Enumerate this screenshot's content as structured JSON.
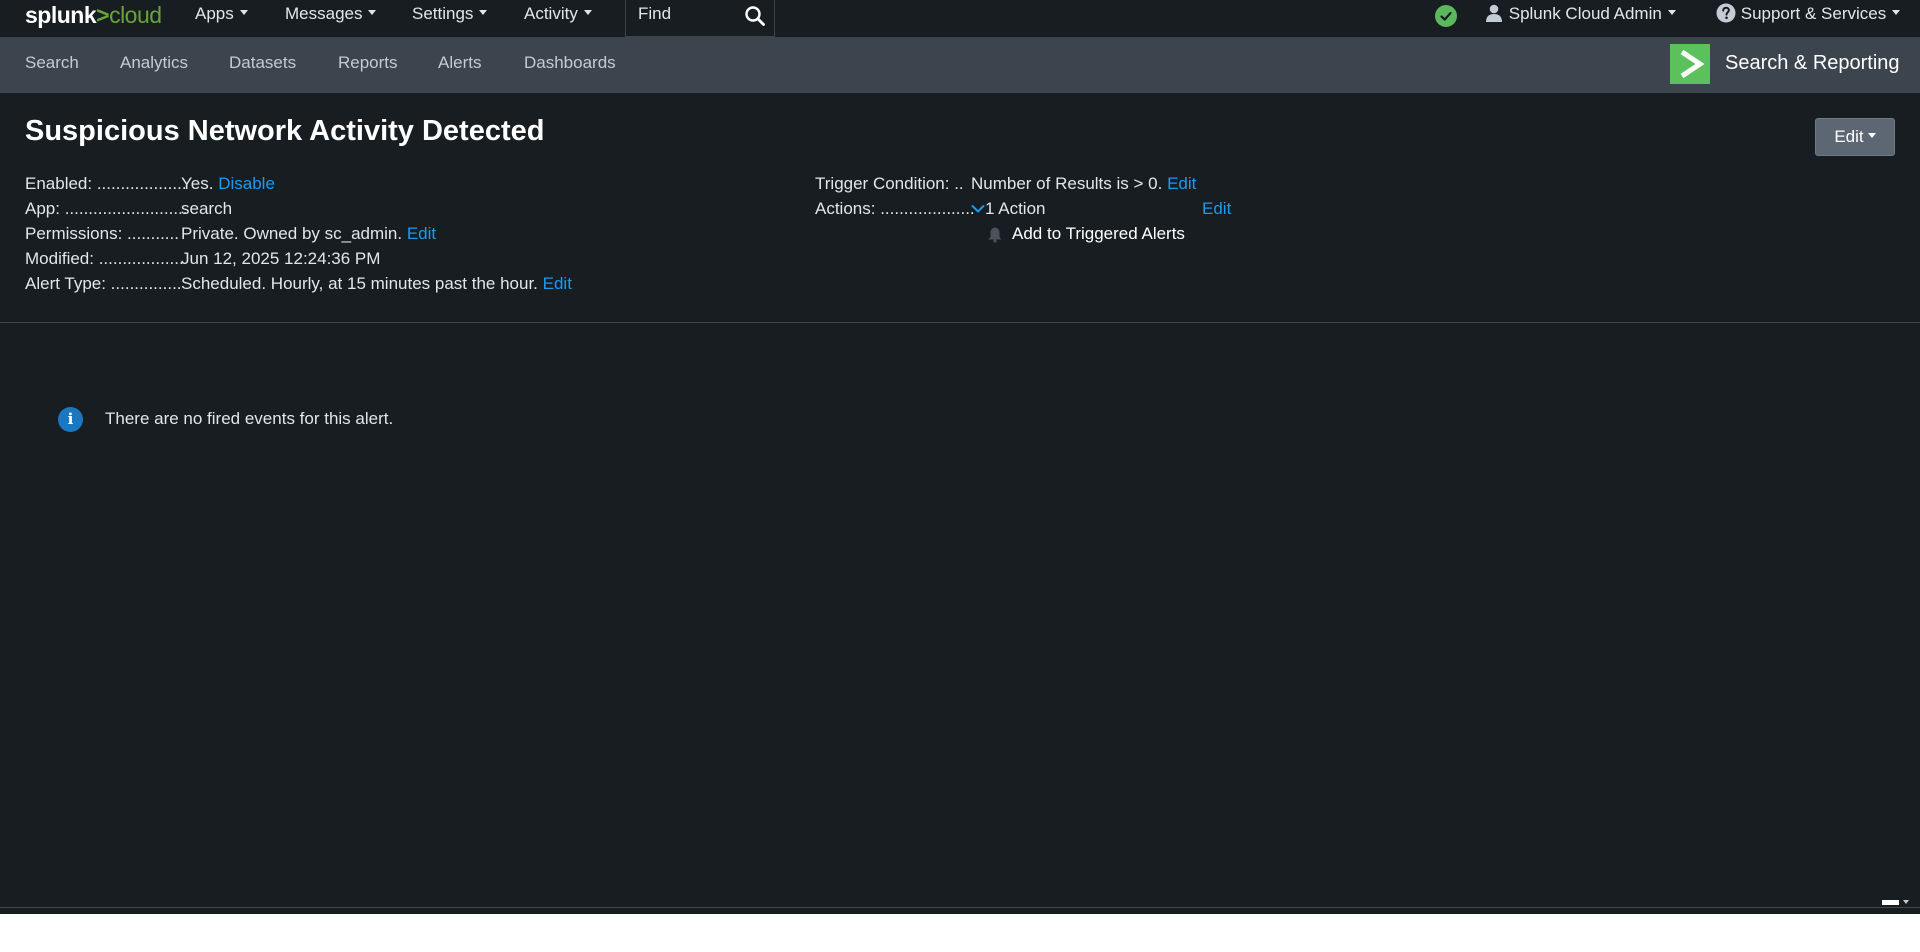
{
  "topbar": {
    "logo": {
      "part1": "splunk",
      "part2": ">",
      "part3": "cloud"
    },
    "menus": [
      {
        "label": "Apps"
      },
      {
        "label": "Messages"
      },
      {
        "label": "Settings"
      },
      {
        "label": "Activity"
      }
    ],
    "find_placeholder": "Find",
    "user_label": "Splunk Cloud Admin",
    "support_label": "Support & Services"
  },
  "navbar": {
    "items": [
      {
        "label": "Search"
      },
      {
        "label": "Analytics"
      },
      {
        "label": "Datasets"
      },
      {
        "label": "Reports"
      },
      {
        "label": "Alerts"
      },
      {
        "label": "Dashboards"
      }
    ],
    "app_title": "Search & Reporting"
  },
  "alert": {
    "title": "Suspicious Network Activity Detected",
    "edit_label": "Edit",
    "details_left": [
      {
        "label": "Enabled: ...................",
        "value": "Yes.",
        "link": "Disable"
      },
      {
        "label": "App: ..........................",
        "value": "search",
        "link": ""
      },
      {
        "label": "Permissions: ...........",
        "value": "Private. Owned by sc_admin.",
        "link": "Edit"
      },
      {
        "label": "Modified: ..................",
        "value": "Jun 12, 2025 12:24:36 PM",
        "link": ""
      },
      {
        "label": "Alert Type: ...............",
        "value": "Scheduled. Hourly, at 15 minutes past the hour.",
        "link": "Edit"
      }
    ],
    "trigger_condition": {
      "label": "Trigger Condition: ..",
      "value": "Number of Results is > 0.",
      "link": "Edit"
    },
    "actions": {
      "label": "Actions: ....................",
      "value": "1 Action",
      "link": "Edit",
      "action_item": "Add to Triggered Alerts"
    }
  },
  "fired_events": {
    "message": "There are no fired events for this alert."
  },
  "colors": {
    "background": "#171d21",
    "navbar": "#3c444d",
    "link": "#1a9bf2",
    "brand_green": "#65a637",
    "status_ok": "#5cb85c"
  }
}
